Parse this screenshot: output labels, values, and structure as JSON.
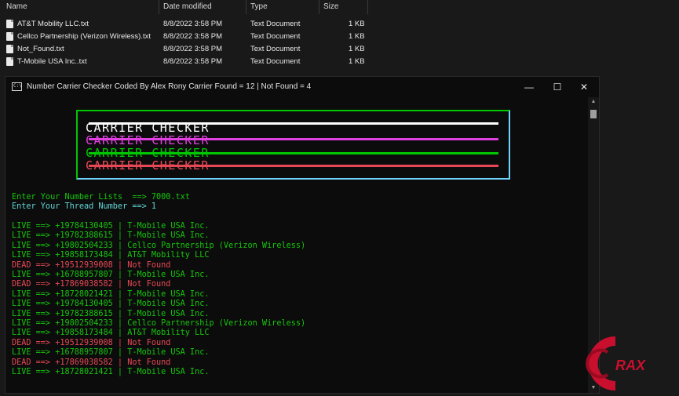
{
  "explorer": {
    "columns": [
      "Name",
      "Date modified",
      "Type",
      "Size"
    ],
    "files": [
      {
        "name": "AT&T Mobility LLC.txt",
        "date": "8/8/2022 3:58 PM",
        "type": "Text Document",
        "size": "1 KB"
      },
      {
        "name": "Cellco Partnership (Verizon Wireless).txt",
        "date": "8/8/2022 3:58 PM",
        "type": "Text Document",
        "size": "1 KB"
      },
      {
        "name": "Not_Found.txt",
        "date": "8/8/2022 3:58 PM",
        "type": "Text Document",
        "size": "1 KB"
      },
      {
        "name": "T-Mobile USA Inc..txt",
        "date": "8/8/2022 3:58 PM",
        "type": "Text Document",
        "size": "1 KB"
      }
    ]
  },
  "console": {
    "title": "Number Carrier Checker Coded By Alex Rony Carrier Found = 12 | Not Found = 4",
    "icon_text": "C:\\",
    "minimize": "—",
    "maximize": "☐",
    "close": "✕",
    "banner_text": "CARRIER CHECKER",
    "banner_colors": [
      "#ffffff",
      "#e040e0",
      "#00c800",
      "#e74856"
    ],
    "prompt_list": "Enter Your Number Lists  ==> 7000.txt",
    "prompt_thread": "Enter Your Thread Number ==> 1",
    "results": [
      {
        "status": "LIVE",
        "text": "LIVE ==> +19784130405 | T-Mobile USA Inc."
      },
      {
        "status": "LIVE",
        "text": "LIVE ==> +19782388615 | T-Mobile USA Inc."
      },
      {
        "status": "LIVE",
        "text": "LIVE ==> +19802504233 | Cellco Partnership (Verizon Wireless)"
      },
      {
        "status": "LIVE",
        "text": "LIVE ==> +19858173484 | AT&T Mobility LLC"
      },
      {
        "status": "DEAD",
        "text": "DEAD ==> +19512939008 | Not Found"
      },
      {
        "status": "LIVE",
        "text": "LIVE ==> +16788957807 | T-Mobile USA Inc."
      },
      {
        "status": "DEAD",
        "text": "DEAD ==> +17869038582 | Not Found"
      },
      {
        "status": "LIVE",
        "text": "LIVE ==> +18728021421 | T-Mobile USA Inc."
      },
      {
        "status": "LIVE",
        "text": "LIVE ==> +19784130405 | T-Mobile USA Inc."
      },
      {
        "status": "LIVE",
        "text": "LIVE ==> +19782388615 | T-Mobile USA Inc."
      },
      {
        "status": "LIVE",
        "text": "LIVE ==> +19802504233 | Cellco Partnership (Verizon Wireless)"
      },
      {
        "status": "LIVE",
        "text": "LIVE ==> +19858173484 | AT&T Mobility LLC"
      },
      {
        "status": "DEAD",
        "text": "DEAD ==> +19512939008 | Not Found"
      },
      {
        "status": "LIVE",
        "text": "LIVE ==> +16788957807 | T-Mobile USA Inc."
      },
      {
        "status": "DEAD",
        "text": "DEAD ==> +17869038582 | Not Found"
      },
      {
        "status": "LIVE",
        "text": "LIVE ==> +18728021421 | T-Mobile USA Inc."
      }
    ]
  },
  "watermark": {
    "text": "RAX",
    "color": "#c8102e"
  }
}
